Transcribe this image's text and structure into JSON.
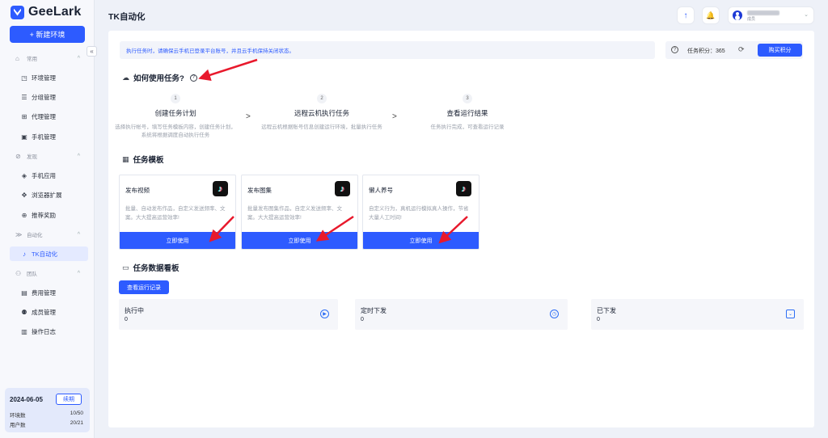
{
  "app": {
    "brand": "GeeLark"
  },
  "sidebar": {
    "new_env_label": "+ 新建环境",
    "collapse_glyph": "«",
    "groups": [
      {
        "label": "常用",
        "icon": "home-icon",
        "glyph": "⌂"
      },
      {
        "label": "发现",
        "icon": "discover-icon",
        "glyph": "⊘"
      },
      {
        "label": "自动化",
        "icon": "automation-icon",
        "glyph": "≫"
      },
      {
        "label": "团队",
        "icon": "team-icon",
        "glyph": "⚇"
      }
    ],
    "items": [
      {
        "label": "环境管理",
        "icon": "env-icon",
        "glyph": "◳"
      },
      {
        "label": "分组管理",
        "icon": "group-icon",
        "glyph": "☰"
      },
      {
        "label": "代理管理",
        "icon": "proxy-icon",
        "glyph": "⊞"
      },
      {
        "label": "手机管理",
        "icon": "phone-icon",
        "glyph": "▣"
      },
      {
        "label": "手机应用",
        "icon": "app-icon",
        "glyph": "◈"
      },
      {
        "label": "浏览器扩展",
        "icon": "extension-icon",
        "glyph": "✥"
      },
      {
        "label": "推荐奖励",
        "icon": "gift-icon",
        "glyph": "⊕"
      },
      {
        "label": "TK自动化",
        "icon": "tiktok-icon",
        "glyph": "♪",
        "active": true
      },
      {
        "label": "费用管理",
        "icon": "billing-icon",
        "glyph": "▤"
      },
      {
        "label": "成员管理",
        "icon": "members-icon",
        "glyph": "⚉"
      },
      {
        "label": "操作日志",
        "icon": "log-icon",
        "glyph": "▥"
      }
    ],
    "plan": {
      "date": "2024-06-05",
      "renew_label": "续期",
      "env_count_label": "环境数",
      "env_count_value": "10/50",
      "user_count_label": "用户数",
      "user_count_value": "20/21"
    }
  },
  "header": {
    "title": "TK自动化",
    "upload_glyph": "↑",
    "bell_glyph": "🔔",
    "user_role": "成员",
    "caret": "⌄"
  },
  "notice": {
    "text": "执行任务时，请确保云手机已登录平台账号，并且云手机保持关闭状态。",
    "points_label": "任务积分：365",
    "help_glyph": "?",
    "refresh_glyph": "⟳",
    "buy_label": "购买积分"
  },
  "howto": {
    "title": "如何使用任务?",
    "help_glyph": "?",
    "cloud_glyph": "☁",
    "arrow_glyph": ">",
    "steps": [
      {
        "num": "1",
        "title": "创建任务计划",
        "desc": "选择执行帐号，填写任务模板内容，创建任务计划，系统将根据调度自动执行任务"
      },
      {
        "num": "2",
        "title": "远程云机执行任务",
        "desc": "远程云机根据账号信息创建运行环境，批量执行任务"
      },
      {
        "num": "3",
        "title": "查看运行结果",
        "desc": "任务执行完成，可查看运行记录"
      }
    ]
  },
  "templates": {
    "title": "任务模板",
    "grid_glyph": "▦",
    "tiktok_glyph": "♪",
    "cards": [
      {
        "name": "发布视频",
        "desc": "批量、自动发布作品，自定义发送频率、文案。大大提高运营效率!",
        "button": "立即使用"
      },
      {
        "name": "发布图集",
        "desc": "批量发布图集作品，自定义发送频率、文案。大大提高运营效率!",
        "button": "立即使用"
      },
      {
        "name": "懒人养号",
        "desc": "自定义行为，真机运行模拟真人操作，节省大量人工时间!",
        "button": "立即使用"
      }
    ]
  },
  "dashboard": {
    "title": "任务数据看板",
    "board_glyph": "▭",
    "records_button": "查看运行记录",
    "stats": [
      {
        "label": "执行中",
        "value": "0",
        "icon": "play-icon",
        "glyph": "▶"
      },
      {
        "label": "定时下发",
        "value": "0",
        "icon": "clock-icon",
        "glyph": "◷"
      },
      {
        "label": "已下发",
        "value": "0",
        "icon": "download-icon",
        "glyph": "⌄"
      }
    ]
  },
  "colors": {
    "accent": "#2d5bff",
    "annotation": "#e8192c"
  }
}
